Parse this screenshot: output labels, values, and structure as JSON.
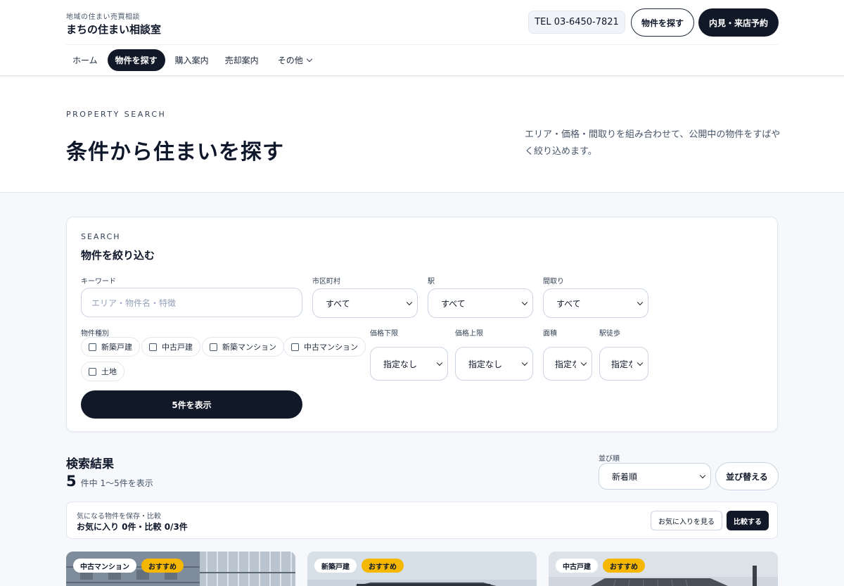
{
  "header": {
    "tagline": "地域の住まい売買相談",
    "brand": "まちの住まい相談室",
    "tel": "TEL 03-6450-7821",
    "search_button": "物件を探す",
    "reserve_button": "内見・来店予約"
  },
  "nav": {
    "items": [
      {
        "label": "ホーム"
      },
      {
        "label": "物件を探す"
      },
      {
        "label": "購入案内"
      },
      {
        "label": "売却案内"
      },
      {
        "label": "その他"
      }
    ]
  },
  "hero": {
    "eyebrow": "PROPERTY SEARCH",
    "title": "条件から住まいを探す",
    "description": "エリア・価格・間取りを組み合わせて、公開中の物件をすばやく絞り込めます。"
  },
  "search": {
    "eyebrow": "SEARCH",
    "title": "物件を絞り込む",
    "keyword_label": "キーワード",
    "keyword_placeholder": "エリア・物件名・特徴",
    "city_label": "市区町村",
    "city_value": "すべて",
    "station_label": "駅",
    "station_value": "すべて",
    "layout_label": "間取り",
    "layout_value": "すべて",
    "type_label": "物件種別",
    "types": [
      {
        "label": "新築戸建"
      },
      {
        "label": "中古戸建"
      },
      {
        "label": "新築マンション"
      },
      {
        "label": "中古マンション"
      },
      {
        "label": "土地"
      }
    ],
    "price_min_label": "価格下限",
    "price_min_value": "指定なし",
    "price_max_label": "価格上限",
    "price_max_value": "指定なし",
    "area_label": "面積",
    "area_value": "指定なし",
    "walk_label": "駅徒歩",
    "walk_value": "指定なし",
    "submit_label": "5件を表示"
  },
  "results": {
    "title": "検索結果",
    "count": "5",
    "count_text": "件中 1〜5件を表示",
    "sort_label": "並び順",
    "sort_value": "新着順",
    "sort_button": "並び替える"
  },
  "favorites": {
    "sub": "気になる物件を保存・比較",
    "main": "お気に入り 0件・比較 0/3件",
    "view_button": "お気に入りを見る",
    "compare_button": "比較する"
  },
  "cards": [
    {
      "type": "中古マンション",
      "badge": "おすすめ"
    },
    {
      "type": "新築戸建",
      "badge": "おすすめ"
    },
    {
      "type": "中古戸建",
      "badge": "おすすめ"
    }
  ],
  "colors": {
    "primary": "#111827",
    "accent": "#f5b700",
    "page_bg": "#f6f8fb"
  }
}
